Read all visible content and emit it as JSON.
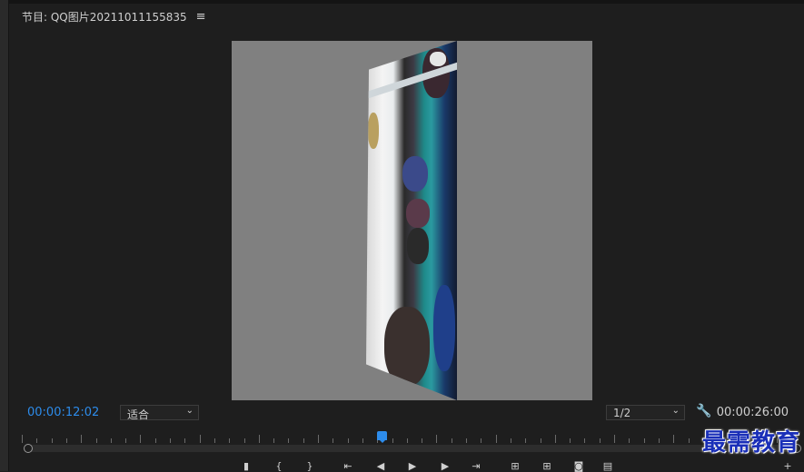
{
  "panel": {
    "title": "节目: QQ图片20211011155835",
    "menu_icon": "hamburger-icon"
  },
  "timecodes": {
    "current": "00:00:12:02",
    "duration": "00:00:26:00"
  },
  "fit": {
    "value": "适合"
  },
  "resolution": {
    "value": "1/2"
  },
  "watermark": {
    "text": "最需教育"
  },
  "colors": {
    "accent": "#2d8ceb",
    "background": "#1e1e1e",
    "viewer_bg": "#808080",
    "watermark": "#1a2fb8"
  },
  "transport_icons": [
    "mark-in-icon",
    "mark-out-icon",
    "go-to-in-icon",
    "step-back-icon",
    "play-icon",
    "step-forward-icon",
    "go-to-out-icon",
    "insert-icon",
    "overwrite-icon",
    "export-frame-icon",
    "button-editor-icon",
    "add-icon"
  ]
}
